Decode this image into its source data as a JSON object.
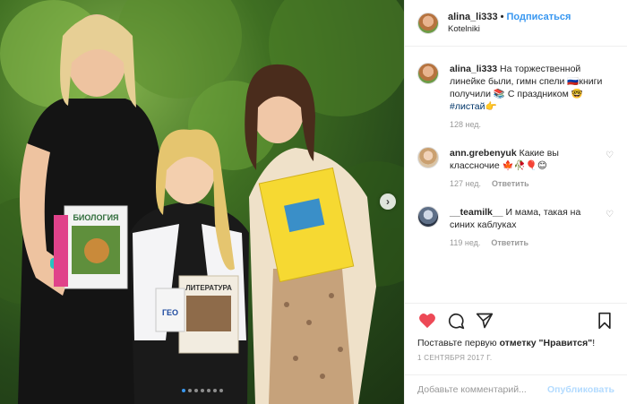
{
  "post": {
    "dots_count": 7,
    "active_dot": 0
  },
  "header": {
    "username": "alina_li333",
    "separator": "•",
    "follow_label": "Подписаться",
    "location": "Kotelniki"
  },
  "caption": {
    "username": "alina_li333",
    "text": "На торжественной линейке были, гимн спели 🇷🇺книги получили 📚 С праздником 🤓",
    "hashtag": "#листай",
    "hashtag_emoji": "👉",
    "age": "128 нед."
  },
  "comments": [
    {
      "username": "ann.grebenyuk",
      "text": "Какие вы классночие 🍁🥀🎈😊",
      "age": "127 нед.",
      "reply_label": "Ответить"
    },
    {
      "username": "__teamilk__",
      "text": "И мама, такая на синих каблуках",
      "age": "119 нед.",
      "reply_label": "Ответить"
    }
  ],
  "actions": {
    "likes_prefix": "Поставьте первую ",
    "likes_link": "отметку \"Нравится\"",
    "likes_suffix": "!",
    "date": "1 СЕНТЯБРЯ 2017 Г."
  },
  "comment_box": {
    "placeholder": "Добавьте комментарий...",
    "publish_label": "Опубликовать"
  },
  "photo_text": {
    "book1_title": "БИОЛОГИЯ",
    "book2_title": "ЛИТЕРАТУРА",
    "book3_title": "ГЕО"
  },
  "colors": {
    "accent": "#3897f0",
    "like_heart": "#ed4956",
    "muted": "#999999"
  }
}
